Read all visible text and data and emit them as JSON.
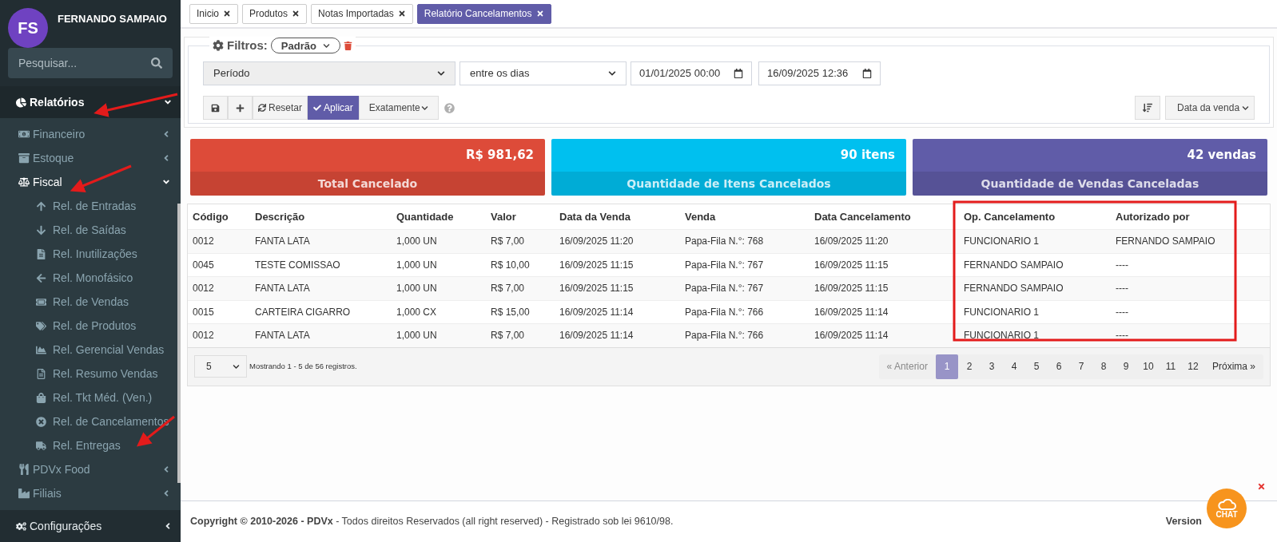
{
  "user": {
    "initials": "FS",
    "name": "FERNANDO SAMPAIO"
  },
  "search": {
    "placeholder": "Pesquisar..."
  },
  "sidebar": {
    "items": [
      {
        "label": "Relatórios",
        "expanded": true,
        "children": [
          {
            "label": "Financeiro",
            "expanded": false
          },
          {
            "label": "Estoque",
            "expanded": false
          },
          {
            "label": "Fiscal",
            "expanded": true,
            "children": [
              {
                "label": "Rel. de Entradas",
                "selected": false
              },
              {
                "label": "Rel. de Saídas",
                "selected": false
              },
              {
                "label": "Rel. Inutilizações",
                "selected": false
              },
              {
                "label": "Rel. Monofásico",
                "selected": false
              },
              {
                "label": "Rel. de Vendas",
                "selected": false
              },
              {
                "label": "Rel. de Produtos",
                "selected": false
              },
              {
                "label": "Rel. Gerencial Vendas",
                "selected": false
              },
              {
                "label": "Rel. Resumo Vendas",
                "selected": false
              },
              {
                "label": "Rel. Tkt Méd. (Ven.)",
                "selected": false
              },
              {
                "label": "Rel. de Cancelamentos",
                "selected": false
              },
              {
                "label": "Rel. Entregas",
                "selected": false
              }
            ]
          },
          {
            "label": "PDVx Food",
            "expanded": false
          },
          {
            "label": "Filiais",
            "expanded": false
          }
        ]
      },
      {
        "label": "Configurações",
        "expanded": false
      }
    ]
  },
  "tabs": [
    {
      "label": "Inicio",
      "selected": false
    },
    {
      "label": "Produtos",
      "selected": false
    },
    {
      "label": "Notas Importadas",
      "selected": false
    },
    {
      "label": "Relatório Cancelamentos",
      "selected": true
    }
  ],
  "filters": {
    "title": "Filtros:",
    "preset": "Padrão",
    "field": "Período",
    "operator": "entre os dias",
    "date_from": "01/01/2025 00:00",
    "date_to": "16/09/2025 12:36",
    "reset": "Resetar",
    "apply": "Aplicar",
    "match": "Exatamente",
    "sort_by": "Data da venda"
  },
  "cards": [
    {
      "value": "R$ 981,62",
      "label": "Total Cancelado",
      "color": "#dd4b39"
    },
    {
      "value": "90 itens",
      "label": "Quantidade de Itens Cancelados",
      "color": "#00c0ef"
    },
    {
      "value": "42 vendas",
      "label": "Quantidade de Vendas Canceladas",
      "color": "#605ca8"
    }
  ],
  "table": {
    "columns": [
      "Código",
      "Descrição",
      "Quantidade",
      "Valor",
      "Data da Venda",
      "Venda",
      "Data Cancelamento",
      "Op. Cancelamento",
      "Autorizado por"
    ],
    "rows": [
      [
        "0012",
        "FANTA LATA",
        "1,000 UN",
        "R$ 7,00",
        "16/09/2025 11:20",
        "Papa-Fila N.°: 768",
        "16/09/2025 11:20",
        "FUNCIONARIO 1",
        "FERNANDO SAMPAIO"
      ],
      [
        "0045",
        "TESTE COMISSAO",
        "1,000 UN",
        "R$ 10,00",
        "16/09/2025 11:15",
        "Papa-Fila N.°: 767",
        "16/09/2025 11:15",
        "FERNANDO SAMPAIO",
        "----"
      ],
      [
        "0012",
        "FANTA LATA",
        "1,000 UN",
        "R$ 7,00",
        "16/09/2025 11:15",
        "Papa-Fila N.°: 767",
        "16/09/2025 11:15",
        "FERNANDO SAMPAIO",
        "----"
      ],
      [
        "0015",
        "CARTEIRA CIGARRO",
        "1,000 CX",
        "R$ 15,00",
        "16/09/2025 11:14",
        "Papa-Fila N.°: 766",
        "16/09/2025 11:14",
        "FUNCIONARIO 1",
        "----"
      ],
      [
        "0012",
        "FANTA LATA",
        "1,000 UN",
        "R$ 7,00",
        "16/09/2025 11:14",
        "Papa-Fila N.°: 766",
        "16/09/2025 11:14",
        "FUNCIONARIO 1",
        "----"
      ]
    ],
    "page_size": "5",
    "summary": "Mostrando 1 - 5 de 56 registros."
  },
  "pagination": {
    "previous": "« Anterior",
    "pages": [
      {
        "label": "1",
        "selected": true
      },
      {
        "label": "2",
        "selected": false
      },
      {
        "label": "3",
        "selected": false
      },
      {
        "label": "4",
        "selected": false
      },
      {
        "label": "5",
        "selected": false
      },
      {
        "label": "6",
        "selected": false
      },
      {
        "label": "7",
        "selected": false
      },
      {
        "label": "8",
        "selected": false
      },
      {
        "label": "9",
        "selected": false
      },
      {
        "label": "10",
        "selected": false
      },
      {
        "label": "11",
        "selected": false
      },
      {
        "label": "12",
        "selected": false
      }
    ],
    "next": "Próxima »"
  },
  "footer": {
    "copyright": "**Copyright © 2010-2026 - PDVx** - Todos direitos Reservados (all right reserved) - Registrado sob lei 9610/98.",
    "version": "Version"
  },
  "chat": {
    "label": "CHAT"
  }
}
